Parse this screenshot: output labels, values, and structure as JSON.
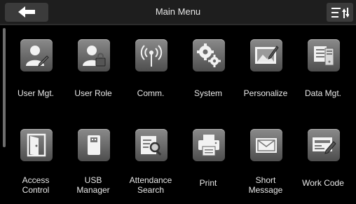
{
  "header": {
    "title": "Main Menu",
    "back_icon": "back-arrow-icon",
    "menu_icon": "sort-menu-icon"
  },
  "colors": {
    "background": "#000000",
    "header_bg": "#1e1e1e",
    "button_bg": "#3b3b3b",
    "tile_gradient_top": "#8a8a8a",
    "tile_gradient_bottom": "#4d4d4d",
    "text": "#e8e8e8"
  },
  "menu": {
    "row1": [
      {
        "label": "User Mgt.",
        "icon": "user-edit-icon"
      },
      {
        "label": "User Role",
        "icon": "user-lock-icon"
      },
      {
        "label": "Comm.",
        "icon": "wireless-signal-icon"
      },
      {
        "label": "System",
        "icon": "gears-icon"
      },
      {
        "label": "Personalize",
        "icon": "picture-edit-icon"
      },
      {
        "label": "Data Mgt.",
        "icon": "database-icon"
      }
    ],
    "row2": [
      {
        "label": "Access Control",
        "line1": "Access",
        "line2": "Control",
        "icon": "door-icon"
      },
      {
        "label": "USB Manager",
        "line1": "USB",
        "line2": "Manager",
        "icon": "usb-drive-icon"
      },
      {
        "label": "Attendance Search",
        "line1": "Attendance",
        "line2": "Search",
        "icon": "document-search-icon"
      },
      {
        "label": "Print",
        "icon": "printer-icon"
      },
      {
        "label": "Short Message",
        "line1": "Short",
        "line2": "Message",
        "icon": "envelope-icon"
      },
      {
        "label": "Work Code",
        "icon": "keyboard-card-icon"
      }
    ]
  }
}
